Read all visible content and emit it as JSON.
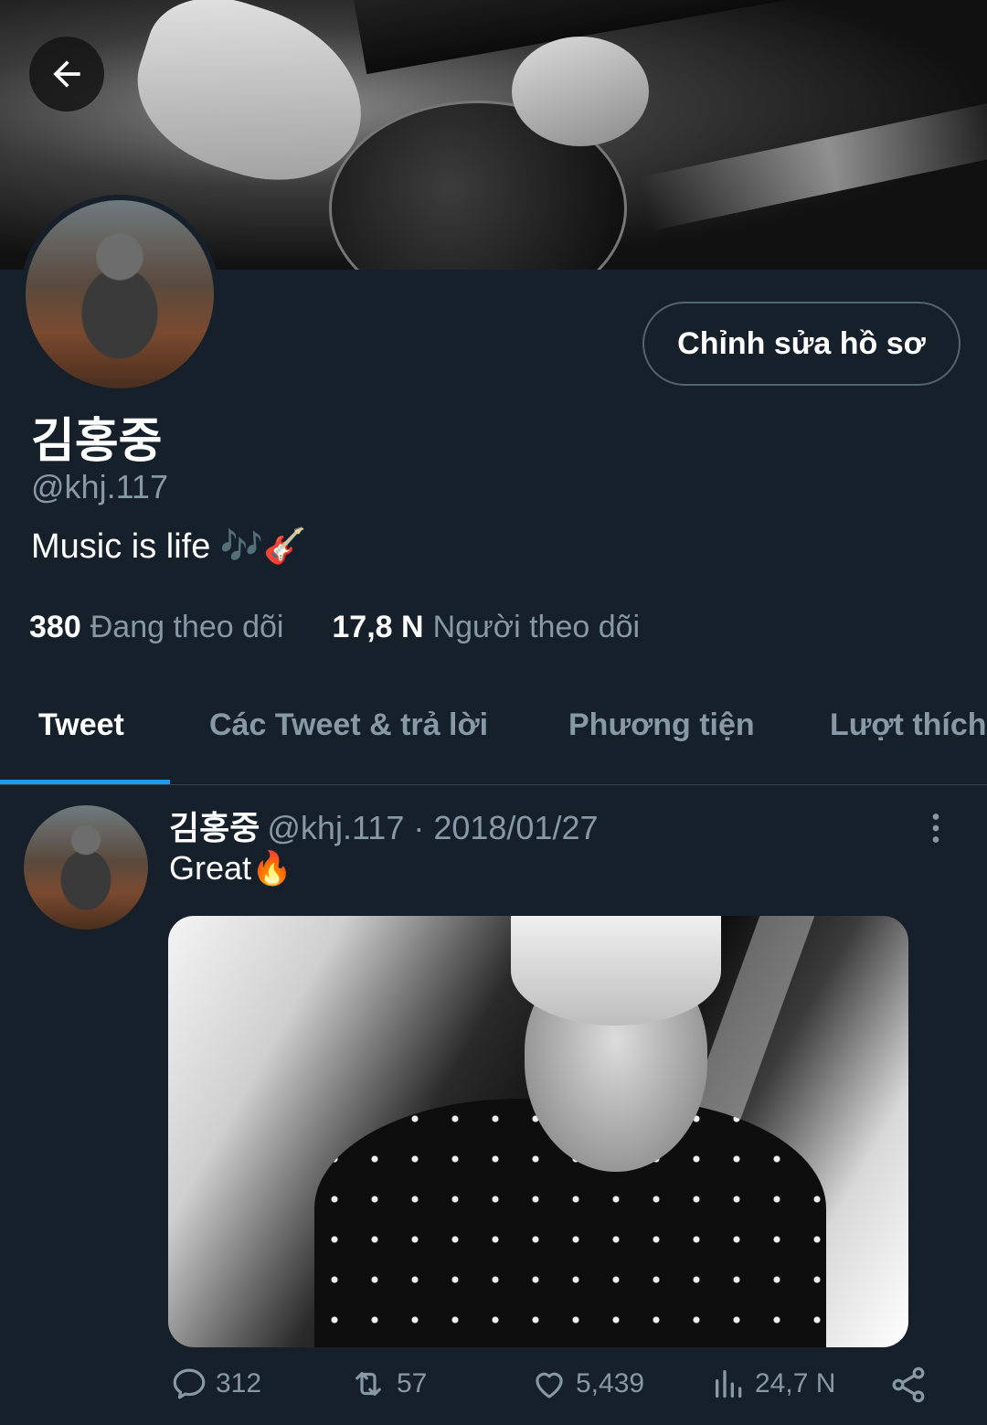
{
  "profile": {
    "name": "김홍중",
    "handle": "@khj.117",
    "bio": "Music is life 🎶🎸",
    "edit_button": "Chỉnh sửa hồ sơ",
    "following_count": "380",
    "following_label": "Đang theo dõi",
    "followers_count": "17,8 N",
    "followers_label": "Người theo dõi"
  },
  "tabs": [
    {
      "label": "Tweet",
      "active": true
    },
    {
      "label": "Các Tweet & trả lời",
      "active": false
    },
    {
      "label": "Phương tiện",
      "active": false
    },
    {
      "label": "Lượt thích",
      "active": false
    }
  ],
  "tweet": {
    "name": "김홍중",
    "meta": "@khj.117 · 2018/01/27",
    "text": "Great🔥",
    "replies": "312",
    "retweets": "57",
    "likes": "5,439",
    "views": "24,7 N"
  },
  "icons": {
    "back": "arrow-left-icon",
    "more": "more-vertical-icon",
    "reply": "reply-icon",
    "retweet": "retweet-icon",
    "like": "heart-icon",
    "views": "views-icon",
    "share": "share-icon"
  },
  "colors": {
    "background": "#15202b",
    "accent": "#1d9bf0",
    "secondary_text": "#8899a6",
    "border": "#536471"
  }
}
